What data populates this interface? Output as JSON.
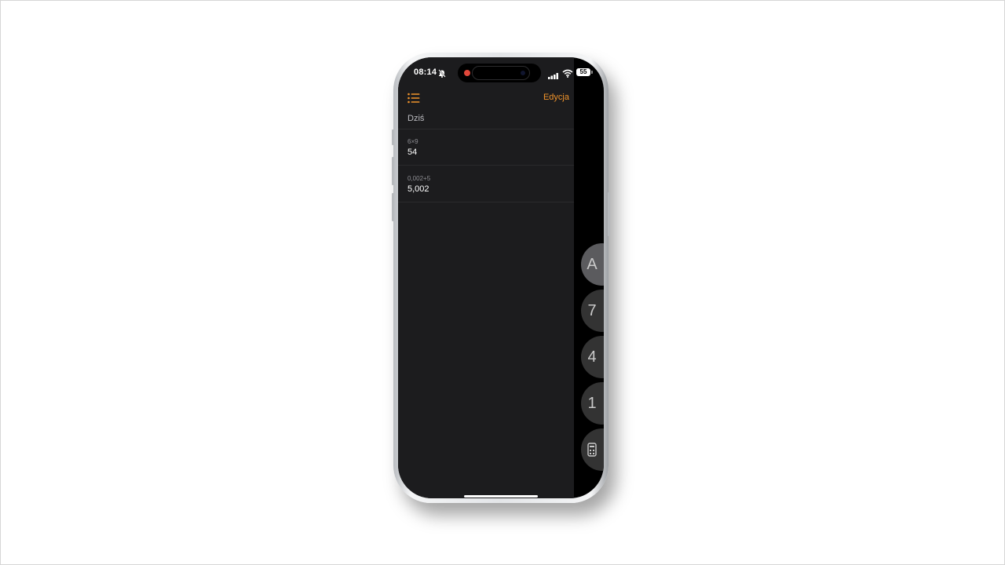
{
  "status_bar": {
    "time": "08:14",
    "battery": "55",
    "icons": [
      "bell-slash-icon",
      "signal-icon",
      "wifi-icon",
      "battery-icon"
    ]
  },
  "toolbar": {
    "history_icon": "list-icon",
    "edit_label": "Edycja"
  },
  "history": {
    "section_label": "Dziś",
    "entries": [
      {
        "expression": "6×9",
        "result": "54"
      },
      {
        "expression": "0,002+5",
        "result": "5,002"
      }
    ]
  },
  "keypad_partial": {
    "keys": [
      "A",
      "7",
      "4",
      "1",
      "calculator-icon"
    ]
  },
  "colors": {
    "accent": "#f0932b",
    "background": "#1c1c1e",
    "key": "#333333",
    "key_ac": "#5b5b5e",
    "record_dot": "#e0473a"
  }
}
